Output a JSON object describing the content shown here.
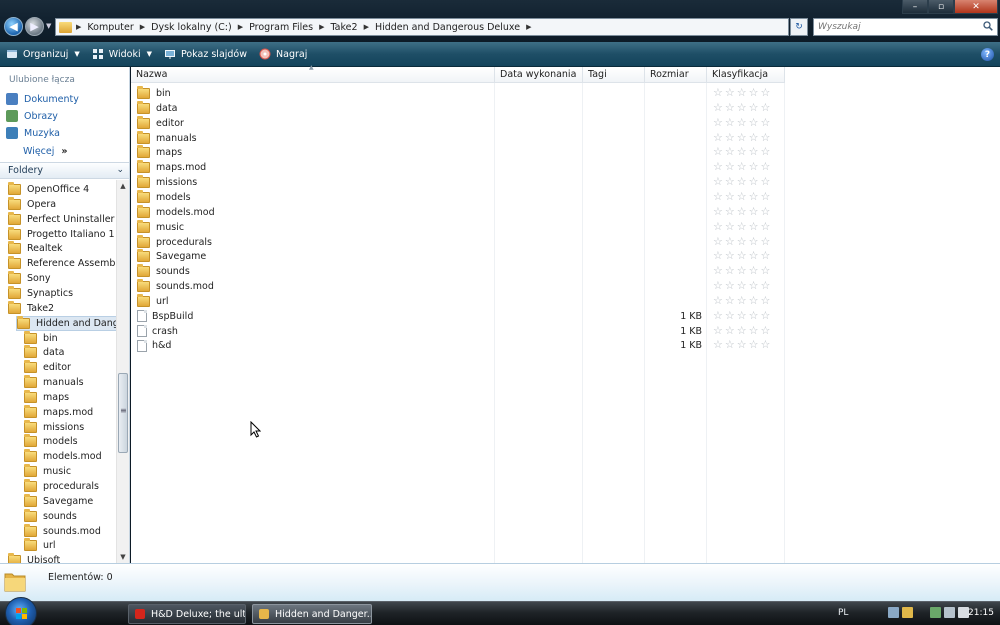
{
  "window": {
    "controls": {
      "minimize": "–",
      "maximize": "▫",
      "close": "✕"
    }
  },
  "address_bar": {
    "breadcrumbs": [
      "Komputer",
      "Dysk lokalny (C:)",
      "Program Files",
      "Take2",
      "Hidden and Dangerous Deluxe"
    ],
    "refresh_symbol": "↻"
  },
  "search": {
    "placeholder": "Wyszukaj"
  },
  "toolbar": {
    "organize": "Organizuj",
    "views": "Widoki",
    "slideshow": "Pokaz slajdów",
    "burn": "Nagraj",
    "help": "?"
  },
  "navigation": {
    "favorites_title": "Ulubione łącza",
    "favorites": [
      {
        "label": "Dokumenty",
        "icon": "documents-icon",
        "color": "#4a7fc0"
      },
      {
        "label": "Obrazy",
        "icon": "pictures-icon",
        "color": "#5d9a5a"
      },
      {
        "label": "Muzyka",
        "icon": "music-icon",
        "color": "#3d7fb8"
      }
    ],
    "more": "Więcej",
    "more_symbol": "»",
    "folders_title": "Foldery",
    "tree": [
      {
        "label": "OpenOffice 4",
        "level": 0
      },
      {
        "label": "Opera",
        "level": 0
      },
      {
        "label": "Perfect Uninstaller",
        "level": 0
      },
      {
        "label": "Progetto Italiano 1",
        "level": 0
      },
      {
        "label": "Realtek",
        "level": 0
      },
      {
        "label": "Reference Assemblies",
        "level": 0
      },
      {
        "label": "Sony",
        "level": 0
      },
      {
        "label": "Synaptics",
        "level": 0
      },
      {
        "label": "Take2",
        "level": 0
      },
      {
        "label": "Hidden and Dangerous Deluxe",
        "level": 1,
        "selected": true
      },
      {
        "label": "bin",
        "level": 2
      },
      {
        "label": "data",
        "level": 2
      },
      {
        "label": "editor",
        "level": 2
      },
      {
        "label": "manuals",
        "level": 2
      },
      {
        "label": "maps",
        "level": 2
      },
      {
        "label": "maps.mod",
        "level": 2
      },
      {
        "label": "missions",
        "level": 2
      },
      {
        "label": "models",
        "level": 2
      },
      {
        "label": "models.mod",
        "level": 2
      },
      {
        "label": "music",
        "level": 2
      },
      {
        "label": "procedurals",
        "level": 2
      },
      {
        "label": "Savegame",
        "level": 2
      },
      {
        "label": "sounds",
        "level": 2
      },
      {
        "label": "sounds.mod",
        "level": 2
      },
      {
        "label": "url",
        "level": 2
      },
      {
        "label": "Ubisoft",
        "level": 0
      }
    ]
  },
  "file_list": {
    "columns": [
      "Nazwa",
      "Data wykonania",
      "Tagi",
      "Rozmiar",
      "Klasyfikacja"
    ],
    "items": [
      {
        "name": "bin",
        "type": "folder",
        "size": "",
        "rating": 0
      },
      {
        "name": "data",
        "type": "folder",
        "size": "",
        "rating": 0
      },
      {
        "name": "editor",
        "type": "folder",
        "size": "",
        "rating": 0
      },
      {
        "name": "manuals",
        "type": "folder",
        "size": "",
        "rating": 0
      },
      {
        "name": "maps",
        "type": "folder",
        "size": "",
        "rating": 0
      },
      {
        "name": "maps.mod",
        "type": "folder",
        "size": "",
        "rating": 0
      },
      {
        "name": "missions",
        "type": "folder",
        "size": "",
        "rating": 0
      },
      {
        "name": "models",
        "type": "folder",
        "size": "",
        "rating": 0
      },
      {
        "name": "models.mod",
        "type": "folder",
        "size": "",
        "rating": 0
      },
      {
        "name": "music",
        "type": "folder",
        "size": "",
        "rating": 0
      },
      {
        "name": "procedurals",
        "type": "folder",
        "size": "",
        "rating": 0
      },
      {
        "name": "Savegame",
        "type": "folder",
        "size": "",
        "rating": 0
      },
      {
        "name": "sounds",
        "type": "folder",
        "size": "",
        "rating": 0
      },
      {
        "name": "sounds.mod",
        "type": "folder",
        "size": "",
        "rating": 0
      },
      {
        "name": "url",
        "type": "folder",
        "size": "",
        "rating": 0
      },
      {
        "name": "BspBuild",
        "type": "file",
        "size": "1 KB",
        "rating": 0
      },
      {
        "name": "crash",
        "type": "file",
        "size": "1 KB",
        "rating": 0
      },
      {
        "name": "h&d",
        "type": "file",
        "size": "1 KB",
        "rating": 0
      }
    ]
  },
  "details_pane": {
    "status": "Elementów: 0"
  },
  "taskbar": {
    "tasks": [
      {
        "label": "H&D Deluxe; the ult...",
        "icon": "opera-icon",
        "color": "#d6261c",
        "active": false
      },
      {
        "label": "Hidden and Danger...",
        "icon": "folder-icon",
        "color": "#e6b64a",
        "active": true
      }
    ],
    "language": "PL",
    "clock": "21:15"
  },
  "colors": {
    "accent": "#1f5fa8",
    "toolbar": "#1e4e66",
    "selection": "#dce7f2"
  }
}
